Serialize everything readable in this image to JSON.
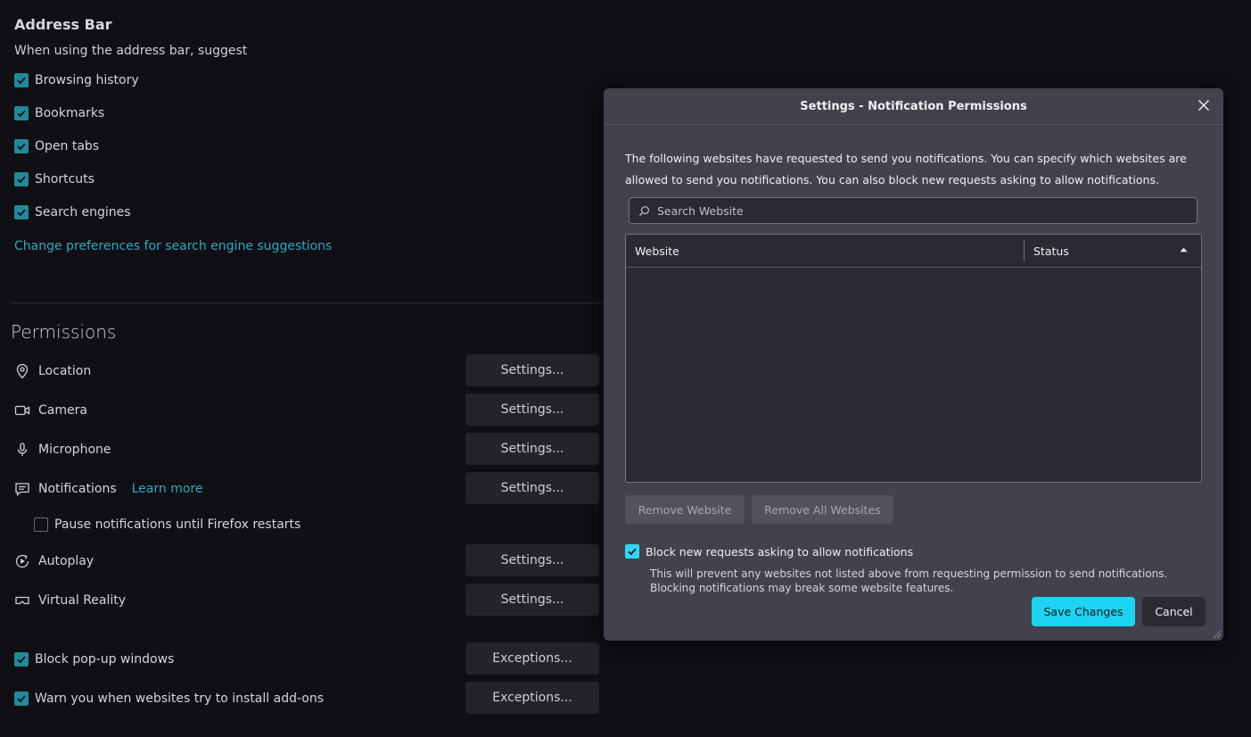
{
  "address_bar": {
    "heading": "Address Bar",
    "subtext": "When using the address bar, suggest",
    "options": [
      {
        "label": "Browsing history",
        "checked": true
      },
      {
        "label": "Bookmarks",
        "checked": true
      },
      {
        "label": "Open tabs",
        "checked": true
      },
      {
        "label": "Shortcuts",
        "checked": true
      },
      {
        "label": "Search engines",
        "checked": true
      }
    ],
    "change_link": "Change preferences for search engine suggestions"
  },
  "permissions": {
    "title": "Permissions",
    "items": [
      {
        "label": "Location",
        "icon": "location-pin-icon",
        "button": "Settings..."
      },
      {
        "label": "Camera",
        "icon": "camera-icon",
        "button": "Settings..."
      },
      {
        "label": "Microphone",
        "icon": "microphone-icon",
        "button": "Settings..."
      },
      {
        "label": "Notifications",
        "icon": "notification-icon",
        "button": "Settings...",
        "link": "Learn more"
      },
      {
        "label": "Autoplay",
        "icon": "autoplay-icon",
        "button": "Settings..."
      },
      {
        "label": "Virtual Reality",
        "icon": "vr-headset-icon",
        "button": "Settings..."
      }
    ],
    "pause_notifications": {
      "label": "Pause notifications until Firefox restarts",
      "checked": false
    },
    "block_popups": {
      "label": "Block pop-up windows",
      "checked": true,
      "button": "Exceptions..."
    },
    "warn_addons": {
      "label": "Warn you when websites try to install add-ons",
      "checked": true,
      "button": "Exceptions..."
    }
  },
  "dialog": {
    "title": "Settings - Notification Permissions",
    "description": "The following websites have requested to send you notifications. You can specify which websites are allowed to send you notifications. You can also block new requests asking to allow notifications.",
    "search_placeholder": "Search Website",
    "columns": {
      "website": "Website",
      "status": "Status"
    },
    "rows": [],
    "remove_website": "Remove Website",
    "remove_all": "Remove All Websites",
    "block_label": "Block new requests asking to allow notifications",
    "block_checked": true,
    "block_note": "This will prevent any websites not listed above from requesting permission to send notifications. Blocking notifications may break some website features.",
    "save": "Save Changes",
    "cancel": "Cancel"
  },
  "colors": {
    "accent": "#1cd4f2",
    "checkbox": "#1f8a9a",
    "link": "#2ea8c0",
    "dialog_bg": "#42414d",
    "page_bg": "#0f0f14"
  }
}
